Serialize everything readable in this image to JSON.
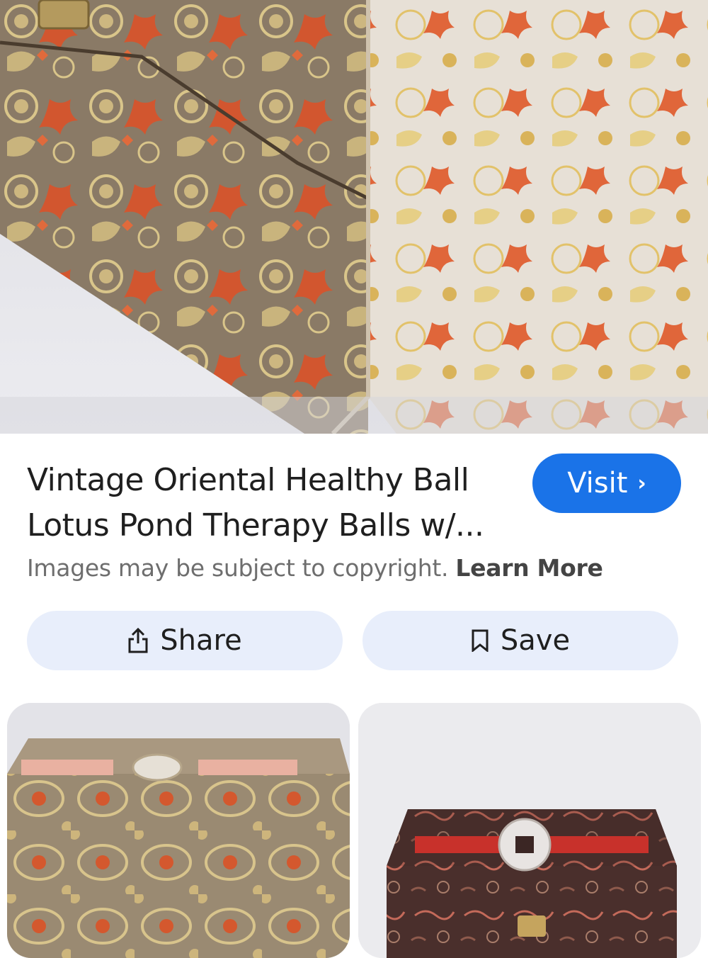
{
  "result": {
    "title": "Vintage Oriental Healthy Ball Lotus Pond Therapy Balls w/...",
    "visit_label": "Visit",
    "copyright_text": "Images may be subject to copyright.",
    "learn_more_label": "Learn More",
    "share_label": "Share",
    "save_label": "Save"
  },
  "icons": {
    "visit": "chevron-right-icon",
    "share": "share-icon",
    "save": "bookmark-icon"
  },
  "colors": {
    "accent": "#1a73e8",
    "button_bg": "#e8eefb"
  }
}
